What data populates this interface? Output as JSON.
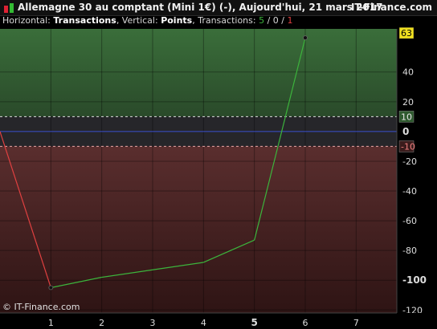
{
  "header": {
    "title": "Allemagne 30 au comptant (Mini 1€) (-), Aujourd'hui, 21 mars 2017",
    "brand": "IT-Finance.com"
  },
  "subtitle": {
    "h_prefix": "Horizontal: ",
    "h_value": "Transactions",
    "v_prefix": ", Vertical: ",
    "v_value": "Points",
    "t_prefix": ", Transactions: ",
    "t_win": "5",
    "sep1": " / ",
    "t_flat": "0",
    "sep2": " / ",
    "t_loss": "1"
  },
  "copyright": "© IT-Finance.com",
  "colors": {
    "win": "#3cb43c",
    "loss": "#e04040",
    "profit_zone": "#2f5a2f",
    "loss_zone": "#4a2424",
    "zero_line": "#3a4fd0",
    "current_badge": "#f0e020"
  },
  "chart_data": {
    "type": "line",
    "x": [
      0,
      1,
      2,
      3,
      4,
      5,
      6
    ],
    "y": [
      0,
      -105,
      -98,
      -93,
      -88,
      -73,
      63
    ],
    "xlim": [
      0,
      7.8
    ],
    "ylim": [
      -122,
      69
    ],
    "x_ticks": [
      "1",
      "2",
      "3",
      "4",
      "5",
      "6",
      "7"
    ],
    "x_tick_values": [
      1,
      2,
      3,
      4,
      5,
      6,
      7
    ],
    "y_ticks": [
      "40",
      "20",
      "0",
      "-20",
      "-40",
      "-60",
      "-80",
      "-100",
      "-120"
    ],
    "y_tick_values": [
      40,
      20,
      0,
      -20,
      -40,
      -60,
      -80,
      -100,
      -120
    ],
    "upper_threshold": {
      "value": 10,
      "label": "10"
    },
    "lower_threshold": {
      "value": -10,
      "label": "-10"
    },
    "current_value": {
      "value": 63,
      "label": "63"
    },
    "markers_at_index": [
      1,
      6
    ]
  }
}
